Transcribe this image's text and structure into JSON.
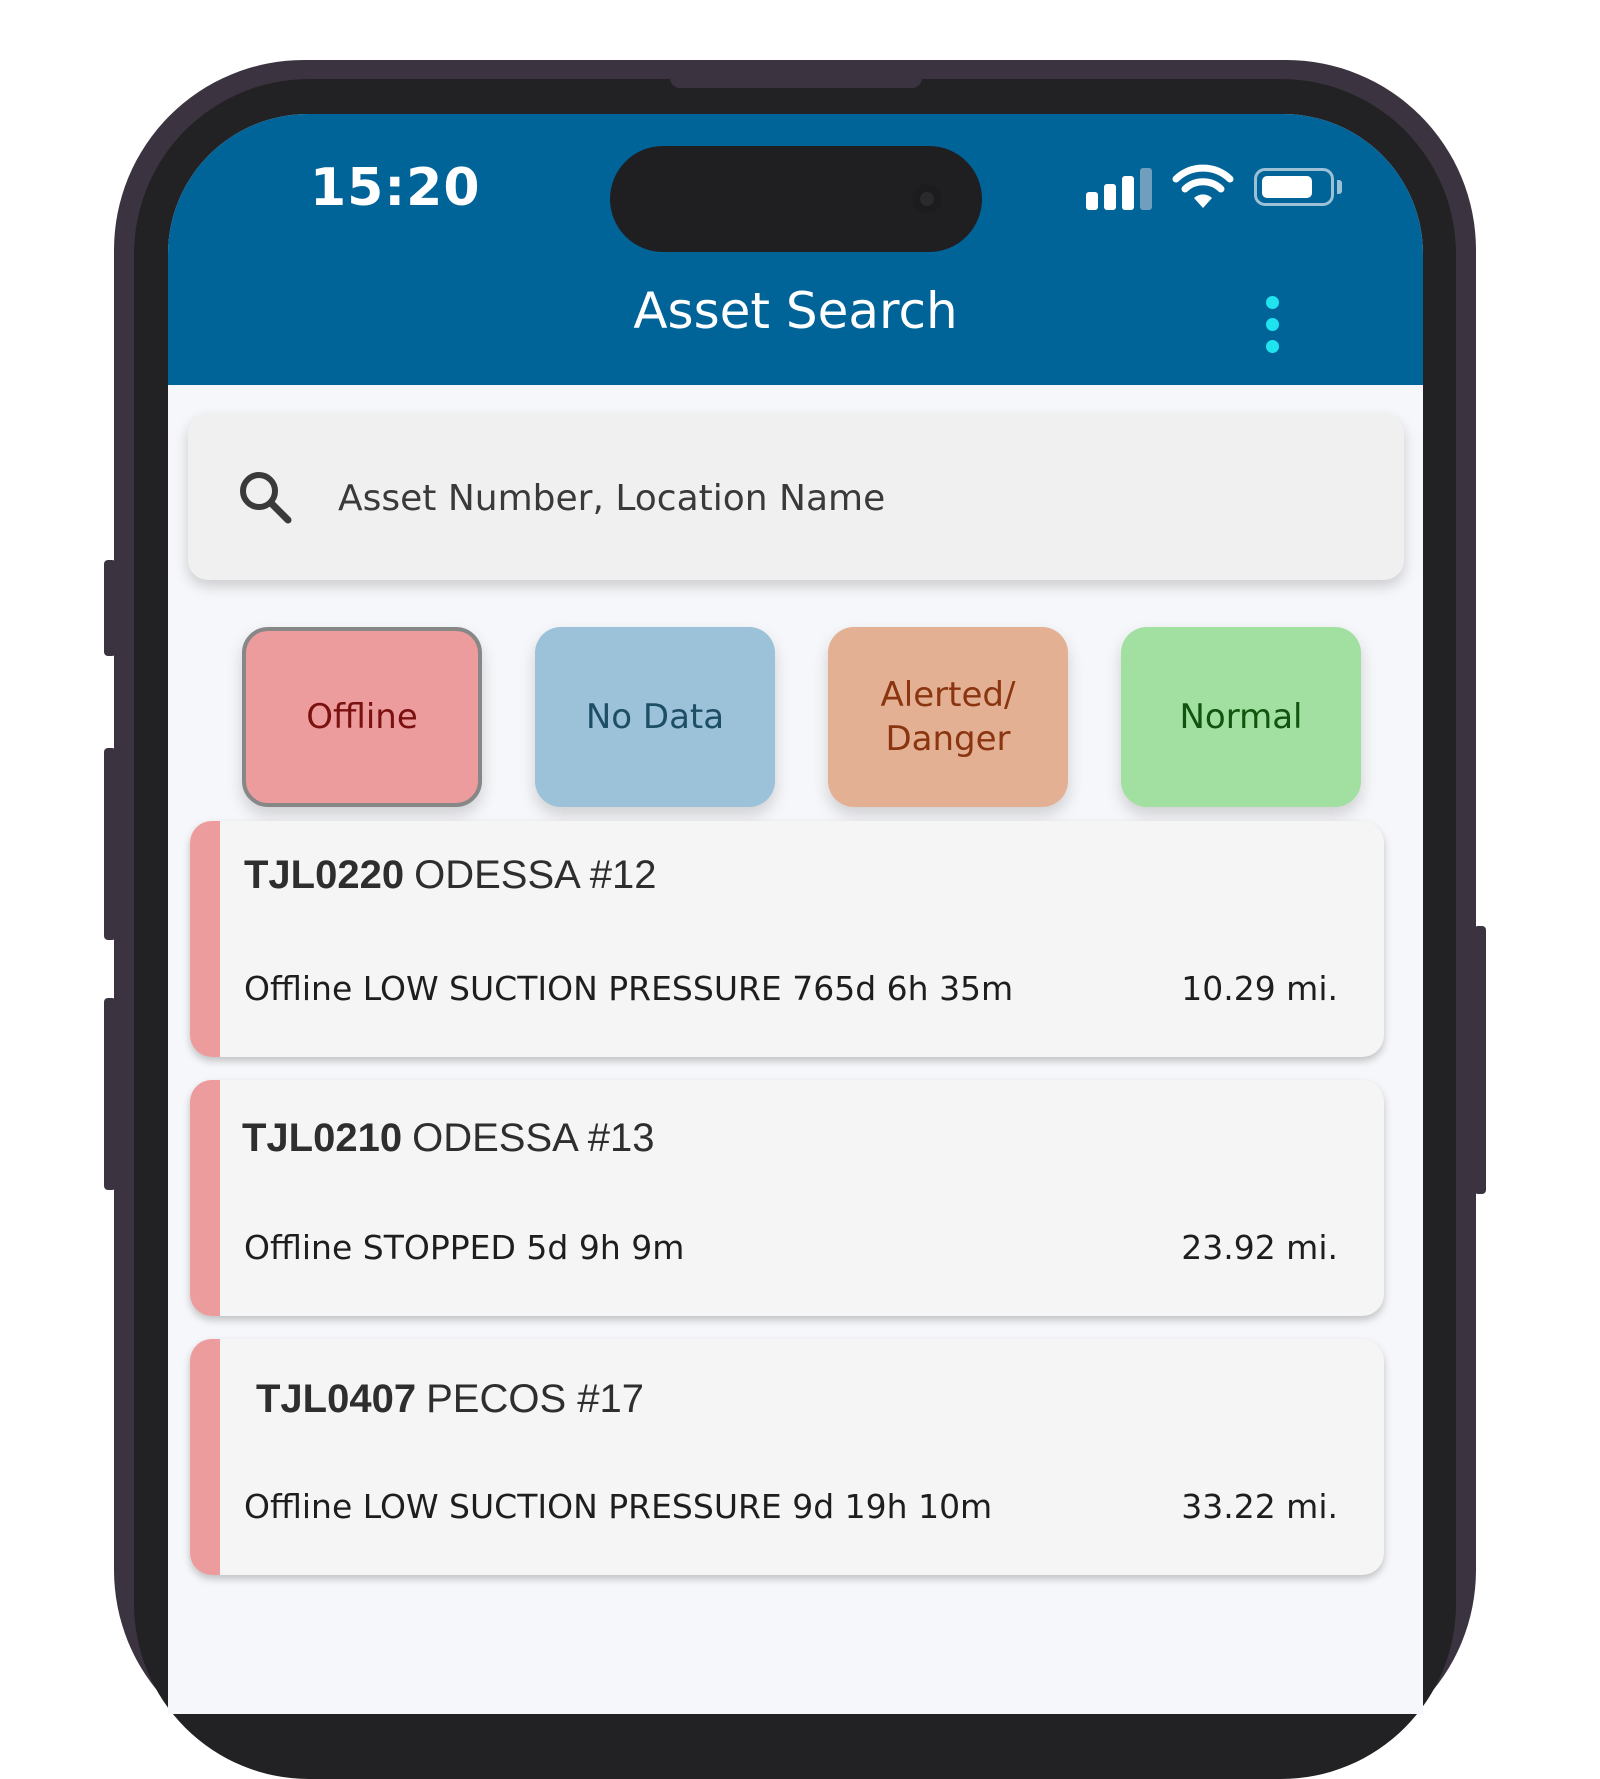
{
  "status_bar": {
    "time": "15:20"
  },
  "header": {
    "title": "Asset Search",
    "background_color": "#016499",
    "menu_icon": "more-vertical-icon",
    "menu_icon_color": "#20e3f0"
  },
  "search": {
    "placeholder": "Asset Number, Location Name",
    "value": "",
    "icon": "search-icon"
  },
  "filters": [
    {
      "label": "Offline",
      "color": "#ec9c9c",
      "selected": true
    },
    {
      "label": "No Data",
      "color": "#9bc2d8",
      "selected": false
    },
    {
      "label": "Alerted/ Danger",
      "color": "#e4b093",
      "selected": false
    },
    {
      "label": "Normal",
      "color": "#a1e0a0",
      "selected": false
    }
  ],
  "assets": [
    {
      "id": "TJL0220",
      "name": "ODESSA #12",
      "status": "Offline LOW SUCTION PRESSURE 765d 6h 35m",
      "distance": "10.29 mi.",
      "status_color": "#ec9c9c"
    },
    {
      "id": "TJL0210",
      "name": "ODESSA #13",
      "status": "Offline STOPPED 5d 9h 9m",
      "distance": "23.92 mi.",
      "status_color": "#ec9c9c"
    },
    {
      "id": "TJL0407",
      "name": "PECOS #17",
      "status": "Offline LOW SUCTION PRESSURE 9d 19h 10m",
      "distance": "33.22 mi.",
      "status_color": "#ec9c9c"
    }
  ]
}
